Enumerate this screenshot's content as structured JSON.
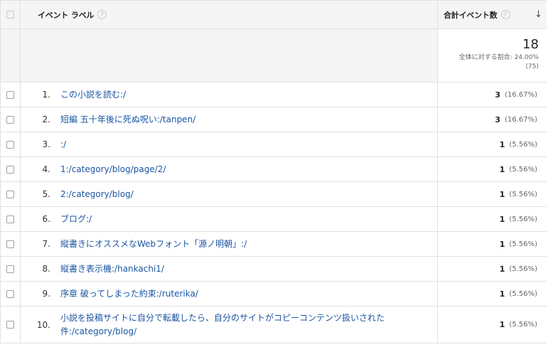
{
  "header": {
    "dimension_label": "イベント ラベル",
    "metric_label": "合計イベント数",
    "help_glyph": "?",
    "sort_glyph": "↓"
  },
  "totals": {
    "value": "18",
    "percent_text": "全体に対する割合: 24.00%",
    "absolute_text": "(75)"
  },
  "rows": [
    {
      "index": "1.",
      "label": "この小説を読む:/",
      "value": "3",
      "percent": "(16.67%)"
    },
    {
      "index": "2.",
      "label": "短編 五十年後に死ぬ呪い:/tanpen/",
      "value": "3",
      "percent": "(16.67%)"
    },
    {
      "index": "3.",
      "label": ":/",
      "value": "1",
      "percent": "(5.56%)"
    },
    {
      "index": "4.",
      "label": "1:/category/blog/page/2/",
      "value": "1",
      "percent": "(5.56%)"
    },
    {
      "index": "5.",
      "label": "2:/category/blog/",
      "value": "1",
      "percent": "(5.56%)"
    },
    {
      "index": "6.",
      "label": "ブログ:/",
      "value": "1",
      "percent": "(5.56%)"
    },
    {
      "index": "7.",
      "label": "縦書きにオススメなWebフォント「源ノ明朝」:/",
      "value": "1",
      "percent": "(5.56%)"
    },
    {
      "index": "8.",
      "label": "縦書き表示機:/hankachi1/",
      "value": "1",
      "percent": "(5.56%)"
    },
    {
      "index": "9.",
      "label": "序章 破ってしまった約束:/ruterika/",
      "value": "1",
      "percent": "(5.56%)"
    },
    {
      "index": "10.",
      "label": "小説を投稿サイトに自分で転載したら、自分のサイトがコピーコンテンツ扱いされた件:/category/blog/",
      "value": "1",
      "percent": "(5.56%)"
    }
  ]
}
